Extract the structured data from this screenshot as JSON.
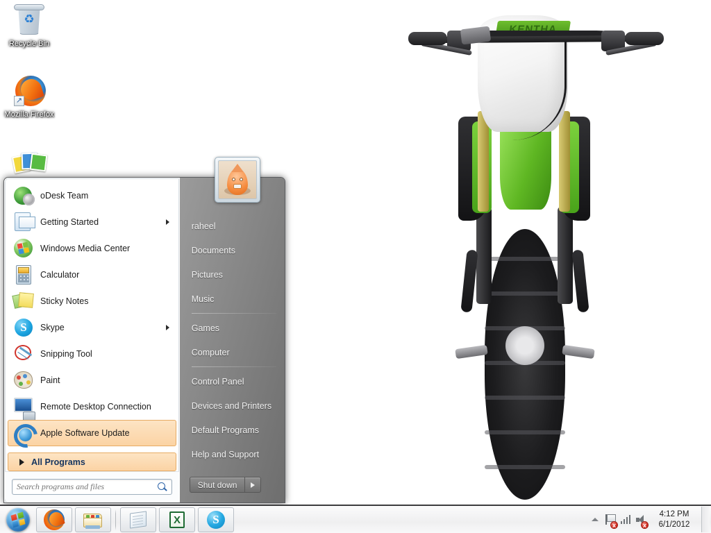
{
  "desktop": {
    "wallpaper_description": "Green and white motocross dirt bike front view on white background",
    "wallpaper_decal_text": "KENTHA",
    "icons": [
      {
        "label": "Recycle Bin",
        "icon": "recycle-bin-icon"
      },
      {
        "label": "Mozilla Firefox",
        "icon": "firefox-icon"
      },
      {
        "label": "",
        "icon": "photos-icon"
      }
    ]
  },
  "start_menu": {
    "programs": [
      {
        "label": "oDesk Team",
        "icon": "odesk-team-icon",
        "has_submenu": false,
        "selected": false
      },
      {
        "label": "Getting Started",
        "icon": "getting-started-icon",
        "has_submenu": true,
        "selected": false
      },
      {
        "label": "Windows Media Center",
        "icon": "windows-media-center-icon",
        "has_submenu": false,
        "selected": false
      },
      {
        "label": "Calculator",
        "icon": "calculator-icon",
        "has_submenu": false,
        "selected": false
      },
      {
        "label": "Sticky Notes",
        "icon": "sticky-notes-icon",
        "has_submenu": false,
        "selected": false
      },
      {
        "label": "Skype",
        "icon": "skype-icon",
        "has_submenu": true,
        "selected": false
      },
      {
        "label": "Snipping Tool",
        "icon": "snipping-tool-icon",
        "has_submenu": false,
        "selected": false
      },
      {
        "label": "Paint",
        "icon": "paint-icon",
        "has_submenu": false,
        "selected": false
      },
      {
        "label": "Remote Desktop Connection",
        "icon": "remote-desktop-icon",
        "has_submenu": false,
        "selected": false
      },
      {
        "label": "Apple Software Update",
        "icon": "apple-software-update-icon",
        "has_submenu": false,
        "selected": true
      }
    ],
    "all_programs_label": "All Programs",
    "search": {
      "placeholder": "Search programs and files",
      "value": "",
      "icon": "search-icon"
    },
    "user": {
      "name": "raheel",
      "avatar": "user-avatar"
    },
    "right_items": [
      {
        "label": "raheel",
        "is_user": true
      },
      {
        "label": "Documents"
      },
      {
        "label": "Pictures"
      },
      {
        "label": "Music"
      },
      {
        "separator_after": true,
        "label": ""
      },
      {
        "label": "Games"
      },
      {
        "label": "Computer"
      },
      {
        "separator_after": true,
        "label": ""
      },
      {
        "label": "Control Panel"
      },
      {
        "label": "Devices and Printers"
      },
      {
        "label": "Default Programs"
      },
      {
        "label": "Help and Support"
      }
    ],
    "shutdown": {
      "label": "Shut down",
      "arrow_icon": "chevron-right-icon"
    },
    "accent_highlight": "#fbd3a4",
    "accent_border": "#e7ab63"
  },
  "taskbar": {
    "start_button": "start-orb",
    "buttons": [
      {
        "label": "Mozilla Firefox",
        "icon": "firefox-icon"
      },
      {
        "label": "Windows Explorer",
        "icon": "explorer-folder-icon"
      },
      {
        "label": "Notepad",
        "icon": "notepad-icon"
      },
      {
        "label": "Microsoft Excel",
        "icon": "excel-icon",
        "glyph": "X"
      },
      {
        "label": "Skype",
        "icon": "skype-icon",
        "glyph": "S"
      }
    ],
    "tray": [
      {
        "name": "show-hidden-icons-icon",
        "label": "Show hidden icons"
      },
      {
        "name": "action-center-flag-icon",
        "label": "Action Center",
        "badge": "x"
      },
      {
        "name": "network-signal-icon",
        "label": "Network"
      },
      {
        "name": "volume-speaker-icon",
        "label": "Volume",
        "badge": "x"
      }
    ],
    "clock": {
      "time": "4:12 PM",
      "date": "6/1/2012"
    },
    "show_desktop_label": "Show desktop"
  }
}
